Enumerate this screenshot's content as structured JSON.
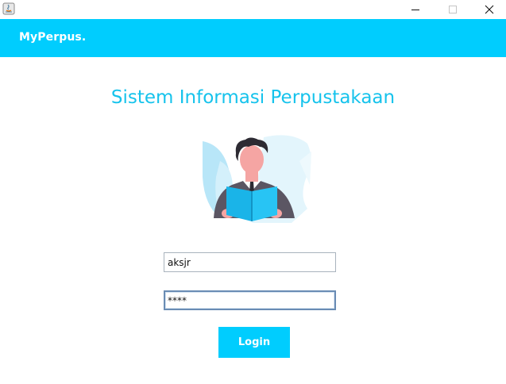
{
  "window": {
    "icons": {
      "app": "java-icon",
      "minimize": "minimize-icon",
      "maximize": "maximize-icon",
      "close": "close-icon"
    }
  },
  "header": {
    "brand": "MyPerpus."
  },
  "main": {
    "title": "Sistem Informasi Perpustakaan",
    "illustration": "person-reading-book-illustration"
  },
  "form": {
    "username_value": "aksjr",
    "password_value": "****",
    "login_label": "Login"
  },
  "colors": {
    "accent": "#00cdfe",
    "title_text": "#16c3ec",
    "white": "#ffffff"
  }
}
